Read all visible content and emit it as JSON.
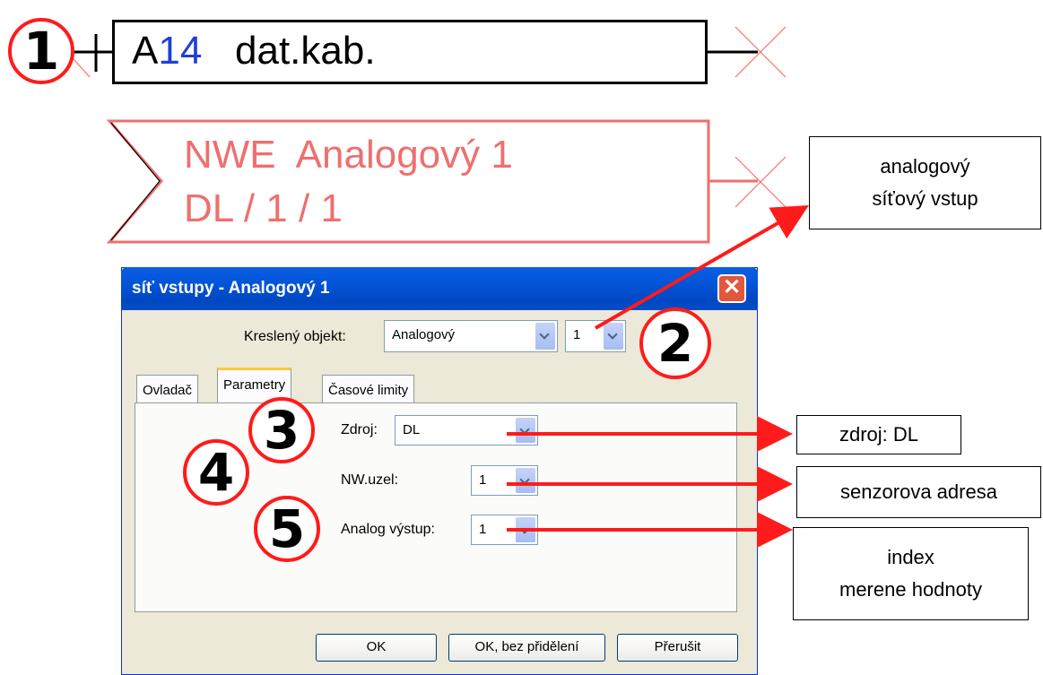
{
  "diagram": {
    "block1": {
      "prefix": "A",
      "number": "14",
      "label": "dat.kab."
    },
    "block2": {
      "line1": "NWE  Analogový 1",
      "line2": "DL / 1 / 1"
    }
  },
  "callouts": {
    "analog": "analogový\nsíťový vstup",
    "source": "zdroj: DL",
    "sensor": "senzorova adresa",
    "index": "index\nmerene hodnoty"
  },
  "markers": [
    "1",
    "2",
    "3",
    "4",
    "5"
  ],
  "dialog": {
    "title": "síť vstupy - Analogový 1",
    "close_label": "✕",
    "object_label": "Kreslený objekt:",
    "object_value": "Analogový",
    "object_index": "1",
    "tabs": [
      "Ovladač",
      "Parametry",
      "Časové limity"
    ],
    "source_label": "Zdroj:",
    "source_value": "DL",
    "node_label": "NW.uzel:",
    "node_value": "1",
    "output_label": "Analog výstup:",
    "output_value": "1",
    "buttons": {
      "ok": "OK",
      "ok_no_assign": "OK, bez přidělení",
      "cancel": "Přerušit"
    }
  },
  "colors": {
    "accent_red": "#ff1b1b",
    "block2_text": "#ef6f6f",
    "number_blue": "#1f3fd6"
  }
}
